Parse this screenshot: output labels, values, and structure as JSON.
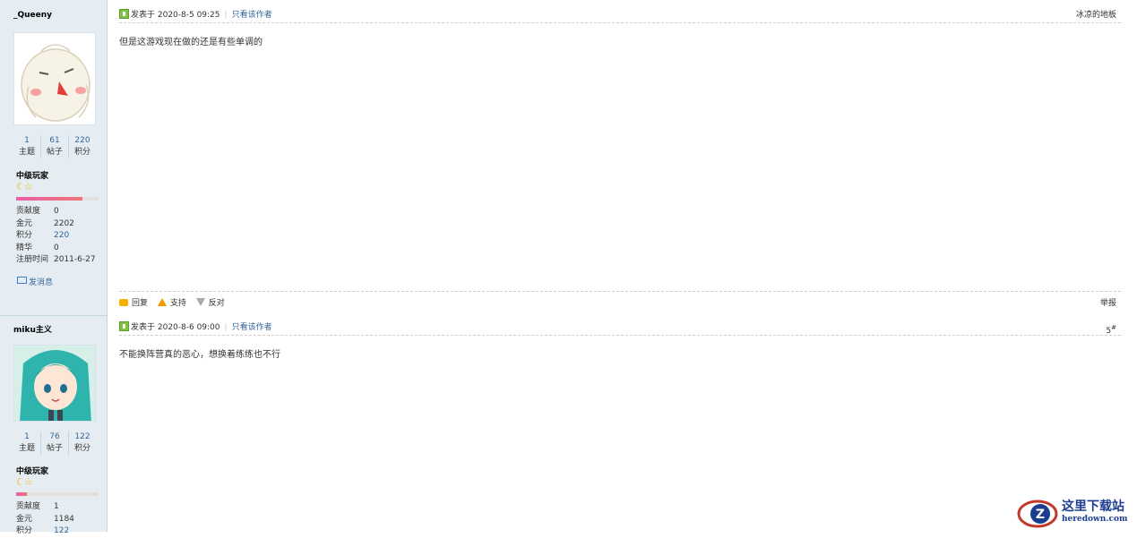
{
  "posts": [
    {
      "author": "_Queeny",
      "stats": [
        {
          "num": "1",
          "label": "主题"
        },
        {
          "num": "61",
          "label": "帖子"
        },
        {
          "num": "220",
          "label": "积分"
        }
      ],
      "rank": "中级玩家",
      "rank_icon": "moon-star-icon",
      "rank_progress": 0.8,
      "info": [
        {
          "key": "贡献度",
          "value": "0"
        },
        {
          "key": "金元",
          "value": "2202"
        },
        {
          "key": "积分",
          "value": "220"
        },
        {
          "key": "精华",
          "value": "0"
        },
        {
          "key": "注册时间",
          "value": "2011-6-27"
        }
      ],
      "message_link": "发消息",
      "posted_at": "发表于 2020-8-5 09:25",
      "only_author": "只看该作者",
      "floor": "冰凉的地板",
      "content": "但是这游戏现在做的还是有些单调的",
      "actions": {
        "reply": "回复",
        "support": "支持",
        "oppose": "反对",
        "report": "举报"
      }
    },
    {
      "author": "miku主义",
      "stats": [
        {
          "num": "1",
          "label": "主题"
        },
        {
          "num": "76",
          "label": "帖子"
        },
        {
          "num": "122",
          "label": "积分"
        }
      ],
      "rank": "中级玩家",
      "rank_icon": "moon-star-icon",
      "rank_progress": 0.13,
      "info": [
        {
          "key": "贡献度",
          "value": "1"
        },
        {
          "key": "金元",
          "value": "1184"
        },
        {
          "key": "积分",
          "value": "122"
        }
      ],
      "posted_at": "发表于 2020-8-6 09:00",
      "only_author": "只看该作者",
      "floor": "5",
      "floor_sup": "#",
      "content": "不能换阵营真的恶心，想换着练练也不行"
    }
  ],
  "watermark": {
    "title": "这里下载站",
    "url": "heredown.com"
  }
}
